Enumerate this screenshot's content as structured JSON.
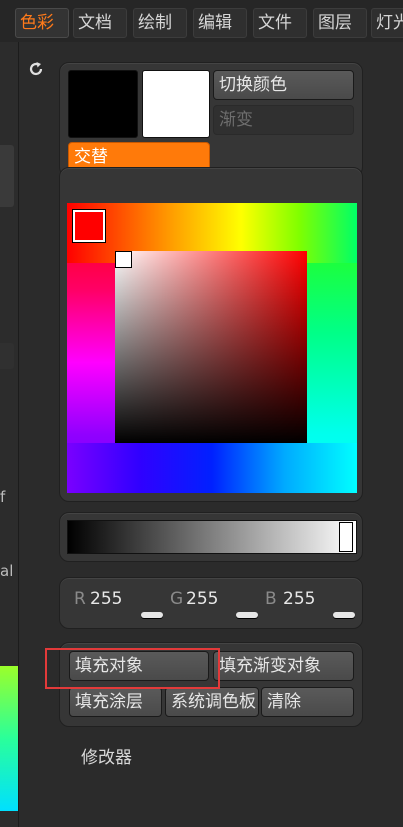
{
  "menu": {
    "items": [
      {
        "label": "色彩",
        "active": true
      },
      {
        "label": "文档",
        "active": false
      },
      {
        "label": "绘制",
        "active": false
      },
      {
        "label": "编辑",
        "active": false
      },
      {
        "label": "文件",
        "active": false
      },
      {
        "label": "图层",
        "active": false
      },
      {
        "label": "灯光",
        "active": false
      }
    ]
  },
  "background": {
    "text_1": "f",
    "text_2": "al"
  },
  "palette": {
    "main_color": "#000000",
    "secondary_color": "#ffffff",
    "switch_color_label": "切换颜色",
    "gradient_label": "渐变",
    "alternate_label": "交替",
    "hue_color": "#ff0000",
    "rgb": {
      "r_label": "R",
      "r_value": "255",
      "g_label": "G",
      "g_value": "255",
      "b_label": "B",
      "b_value": "255"
    },
    "actions": {
      "fill_object": "填充对象",
      "fill_gradient_object": "填充渐变对象",
      "fill_layer": "填充涂层",
      "system_palette": "系统调色板",
      "clear": "清除"
    },
    "modifiers_label": "修改器"
  },
  "colors": {
    "accent": "#ff7a0a",
    "highlight": "#e23a3a"
  }
}
